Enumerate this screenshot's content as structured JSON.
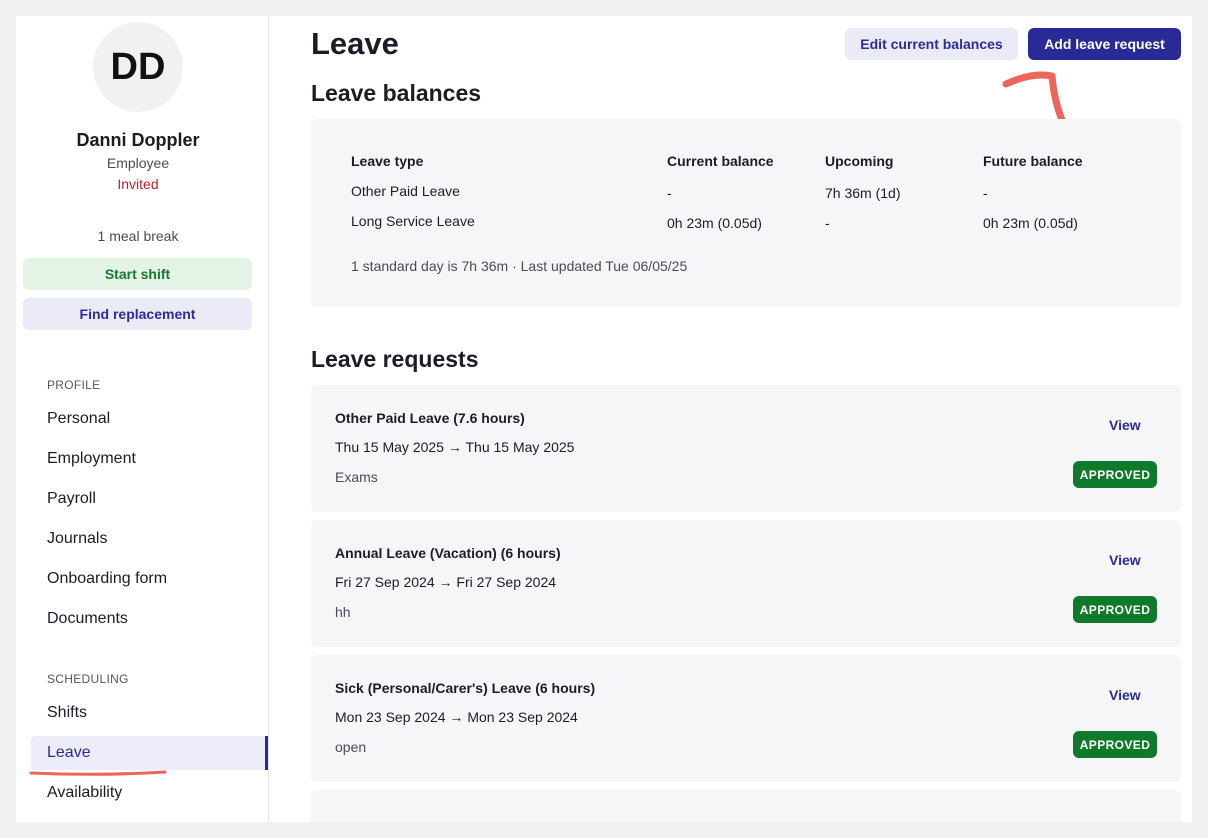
{
  "user": {
    "initials": "DD",
    "name": "Danni Doppler",
    "role": "Employee",
    "status": "Invited",
    "meal_break": "1 meal break",
    "start_shift_label": "Start shift",
    "find_replacement_label": "Find replacement"
  },
  "sidebar": {
    "profile_section": "PROFILE",
    "profile_items": [
      {
        "label": "Personal"
      },
      {
        "label": "Employment"
      },
      {
        "label": "Payroll"
      },
      {
        "label": "Journals"
      },
      {
        "label": "Onboarding form"
      },
      {
        "label": "Documents"
      }
    ],
    "scheduling_section": "SCHEDULING",
    "scheduling_items": [
      {
        "label": "Shifts"
      },
      {
        "label": "Leave"
      },
      {
        "label": "Availability"
      }
    ],
    "active_item": "Leave"
  },
  "header": {
    "title": "Leave",
    "edit_balances_label": "Edit current balances",
    "add_request_label": "Add leave request"
  },
  "balances": {
    "heading": "Leave balances",
    "columns": [
      "Leave type",
      "Current balance",
      "Upcoming",
      "Future balance"
    ],
    "rows": [
      [
        "Other Paid Leave",
        "-",
        "7h 36m (1d)",
        "-"
      ],
      [
        "Long Service Leave",
        "0h 23m (0.05d)",
        "-",
        "0h 23m (0.05d)"
      ]
    ],
    "note": "1 standard day is 7h 36m · Last updated Tue 06/05/25"
  },
  "requests": {
    "heading": "Leave requests",
    "view_label": "View",
    "items": [
      {
        "title": "Other Paid Leave (7.6 hours)",
        "start": "Thu 15 May 2025",
        "end": "Thu 15 May 2025",
        "note": "Exams",
        "status": "APPROVED"
      },
      {
        "title": "Annual Leave (Vacation) (6 hours)",
        "start": "Fri 27 Sep 2024",
        "end": "Fri 27 Sep 2024",
        "note": "hh",
        "status": "APPROVED"
      },
      {
        "title": "Sick (Personal/Carer's) Leave (6 hours)",
        "start": "Mon 23 Sep 2024",
        "end": "Mon 23 Sep 2024",
        "note": "open",
        "status": "APPROVED"
      }
    ]
  },
  "colors": {
    "accent": "#2a2a96",
    "approved": "#0f7a2a",
    "invited": "#c01f2b",
    "annotation": "#f0655a"
  },
  "icons": {
    "date_arrow": "arrow-right-icon"
  }
}
